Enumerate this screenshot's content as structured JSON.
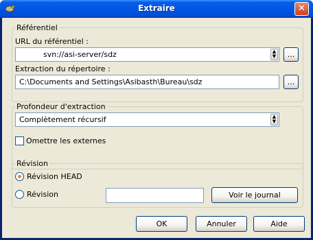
{
  "window": {
    "title": "Extraire",
    "close_glyph": "✕"
  },
  "repository": {
    "group_label": "Référentiel",
    "url_label": "URL du référentiel :",
    "url_value": "svn://asi-server/sdz",
    "browse_label": "...",
    "checkout_dir_label": "Extraction du répertoire :",
    "checkout_dir_value": "C:\\Documents and Settings\\Asibasth\\Bureau\\sdz",
    "dir_browse_label": "..."
  },
  "depth": {
    "group_label": "Profondeur d'extraction",
    "selected": "Complètement récursif",
    "omit_externals_label": "Omettre les externes",
    "omit_externals_checked": false
  },
  "revision": {
    "group_label": "Révision",
    "head_label": "Révision HEAD",
    "head_selected": true,
    "specific_label": "Révision",
    "specific_value": "",
    "show_log_label": "Voir le journal"
  },
  "buttons": {
    "ok": "OK",
    "cancel": "Annuler",
    "help": "Aide"
  },
  "icons": {
    "app": "tortoise-icon",
    "close": "close-icon",
    "combo_arrow": "spin-arrows-icon"
  }
}
